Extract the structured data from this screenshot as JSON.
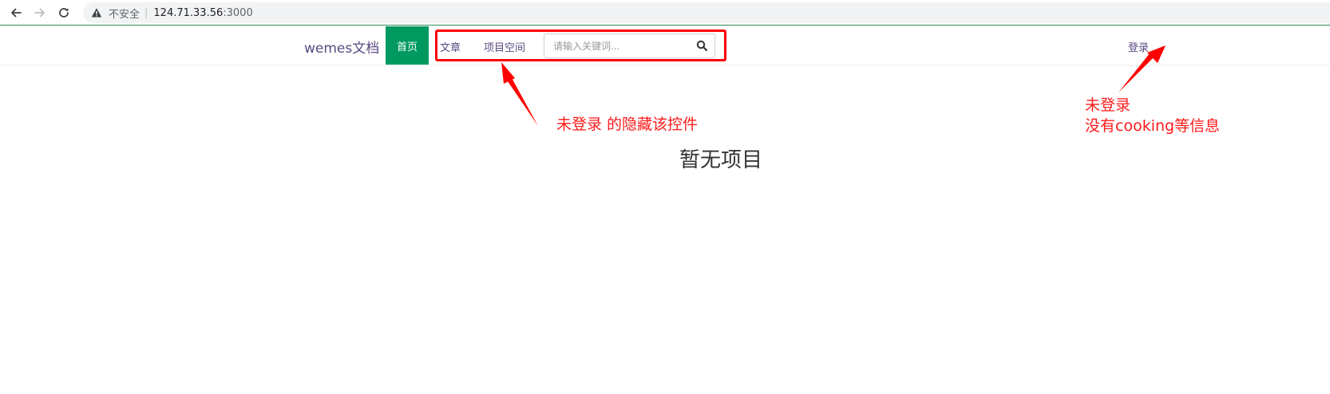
{
  "browser": {
    "insecure_label": "不安全",
    "separator": "|",
    "url_host": "124.71.33.56",
    "url_port": ":3000"
  },
  "header": {
    "brand": "wemes文档",
    "nav": {
      "home": "首页",
      "articles": "文章",
      "project_space": "项目空间"
    },
    "search_placeholder": "请输入关键词...",
    "login": "登录"
  },
  "main": {
    "empty_message": "暂无项目"
  },
  "annotations": {
    "hidden_controls_note": "未登录 的隐藏该控件",
    "login_note_line1": "未登录",
    "login_note_line2": "没有cooking等信息"
  },
  "colors": {
    "brand_green": "#009a61",
    "link_purple": "#5b4a82",
    "annotation_red": "#ff0000"
  }
}
